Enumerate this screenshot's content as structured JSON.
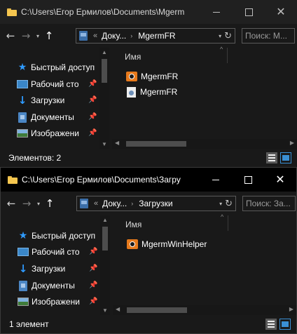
{
  "windows": [
    {
      "title": "C:\\Users\\Егор Ермилов\\Documents\\Mgerm",
      "controls": {
        "minimize": "—",
        "maximize": "☐",
        "close": "✕"
      },
      "address": {
        "overflow": "«",
        "crumbs": [
          "Доку...",
          "MgermFR"
        ]
      },
      "search": {
        "placeholder": "Поиск: M..."
      },
      "sidebar": {
        "items": [
          {
            "label": "Быстрый доступ",
            "icon": "star-icon"
          },
          {
            "label": "Рабочий сто",
            "icon": "desktop-icon"
          },
          {
            "label": "Загрузки",
            "icon": "download-icon"
          },
          {
            "label": "Документы",
            "icon": "documents-icon"
          },
          {
            "label": "Изображени",
            "icon": "pictures-icon"
          }
        ]
      },
      "column_header": "Имя",
      "files": [
        {
          "name": "MgermFR",
          "icon": "app-icon"
        },
        {
          "name": "MgermFR",
          "icon": "config-file-icon"
        }
      ],
      "status": "Элементов: 2"
    },
    {
      "title": "C:\\Users\\Егор Ермилов\\Documents\\Загру",
      "controls": {
        "minimize": "—",
        "maximize": "☐",
        "close": "✕"
      },
      "address": {
        "overflow": "«",
        "crumbs": [
          "Доку...",
          "Загрузки"
        ]
      },
      "search": {
        "placeholder": "Поиск: За..."
      },
      "sidebar": {
        "items": [
          {
            "label": "Быстрый доступ",
            "icon": "star-icon"
          },
          {
            "label": "Рабочий сто",
            "icon": "desktop-icon"
          },
          {
            "label": "Загрузки",
            "icon": "download-icon"
          },
          {
            "label": "Документы",
            "icon": "documents-icon"
          },
          {
            "label": "Изображени",
            "icon": "pictures-icon"
          }
        ]
      },
      "column_header": "Имя",
      "files": [
        {
          "name": "MgermWinHelper",
          "icon": "app-icon"
        }
      ],
      "status": "1 элемент"
    }
  ]
}
